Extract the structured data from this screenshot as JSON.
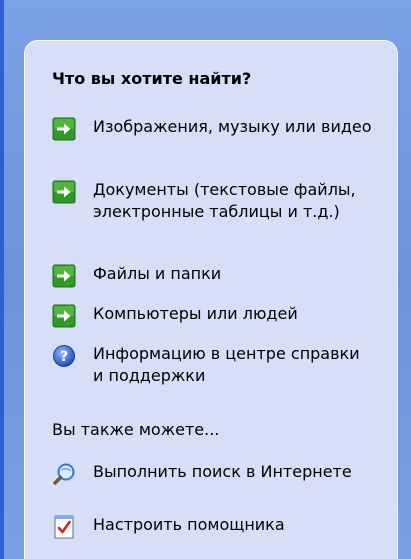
{
  "search_companion": {
    "heading": "Что вы хотите найти?",
    "options": [
      {
        "label": "Изображения, музыку или видео",
        "icon": "green-arrow-icon"
      },
      {
        "label": "Документы (текстовые файлы, электронные таблицы и т.д.)",
        "icon": "green-arrow-icon"
      },
      {
        "label": "Файлы и папки",
        "icon": "green-arrow-icon"
      },
      {
        "label": "Компьютеры или людей",
        "icon": "green-arrow-icon"
      },
      {
        "label": "Информацию в центре справки и поддержки",
        "icon": "help-question-icon"
      }
    ],
    "also_heading": "Вы также можете...",
    "also_options": [
      {
        "label": "Выполнить поиск в Интернете",
        "icon": "internet-search-icon"
      },
      {
        "label": "Настроить помощника",
        "icon": "preferences-icon"
      }
    ]
  },
  "colors": {
    "backdrop": "#7ba2e7",
    "panel": "#d6dff7",
    "arrow_green": "#3fae2a"
  }
}
